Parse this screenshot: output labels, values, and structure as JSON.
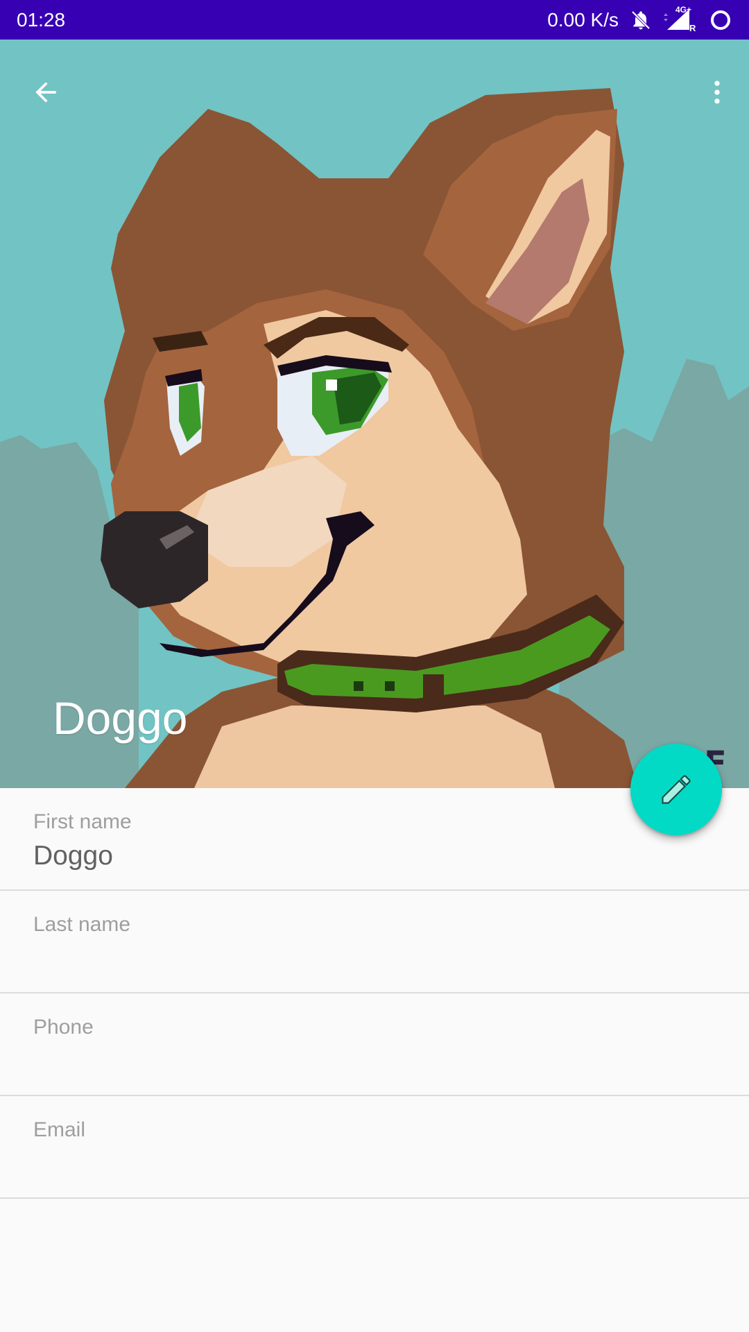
{
  "status_bar": {
    "time": "01:28",
    "network_speed": "0.00 K/s",
    "network_type": "4G+",
    "roaming": "R",
    "icons": [
      "bell-muted-icon",
      "signal-icon",
      "sync-icon"
    ]
  },
  "header": {
    "contact_name": "Doggo",
    "back_icon": "arrow-back-icon",
    "more_icon": "more-vert-icon",
    "background_color": "#72c3c4"
  },
  "fab": {
    "icon": "pencil-icon",
    "color": "#03dac6"
  },
  "fields": [
    {
      "label": "First name",
      "value": "Doggo"
    },
    {
      "label": "Last name",
      "value": ""
    },
    {
      "label": "Phone",
      "value": ""
    },
    {
      "label": "Email",
      "value": ""
    }
  ],
  "colors": {
    "status_bar": "#3700b3",
    "accent": "#03dac6"
  }
}
